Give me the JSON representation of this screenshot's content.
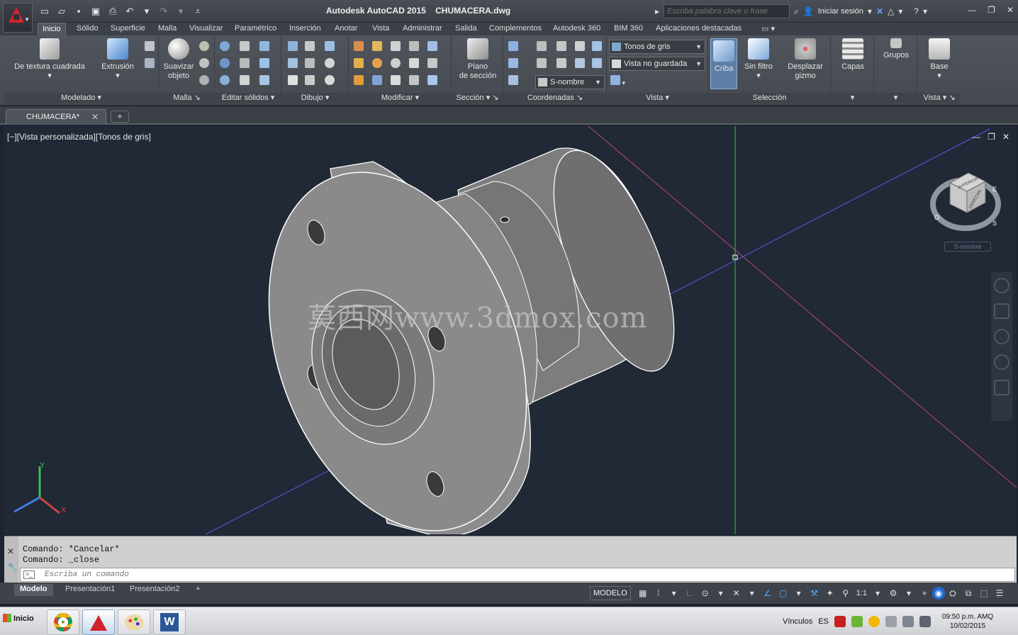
{
  "window": {
    "title": "Autodesk AutoCAD 2015    CHUMACERA.dwg",
    "search_placeholder": "Escriba palabra clave o frase",
    "signin_label": "Iniciar sesión"
  },
  "ribbon_tabs": [
    {
      "label": "Inicio",
      "active": true
    },
    {
      "label": "Sólido"
    },
    {
      "label": "Superficie"
    },
    {
      "label": "Malla"
    },
    {
      "label": "Visualizar"
    },
    {
      "label": "Paramétrico"
    },
    {
      "label": "Inserción"
    },
    {
      "label": "Anotar"
    },
    {
      "label": "Vista"
    },
    {
      "label": "Administrar"
    },
    {
      "label": "Salida"
    },
    {
      "label": "Complementos"
    },
    {
      "label": "Autodesk 360"
    },
    {
      "label": "BIM 360"
    },
    {
      "label": "Aplicaciones destacadas"
    }
  ],
  "panels": {
    "modelado": {
      "title": "Modelado",
      "btn1": "De textura cuadrada",
      "btn2": "Extrusión"
    },
    "malla": {
      "title": "Malla",
      "btn1a": "Suavizar",
      "btn1b": "objeto"
    },
    "editar_solidos": {
      "title": "Editar sólidos"
    },
    "dibujo": {
      "title": "Dibujo"
    },
    "modificar": {
      "title": "Modificar"
    },
    "seccion": {
      "title": "Sección",
      "btn_a": "Plano",
      "btn_b": "de sección"
    },
    "coordenadas": {
      "title": "Coordenadas",
      "ucs_combo": "S-nombre"
    },
    "vista": {
      "title": "Vista",
      "visual_style": "Tonos de gris",
      "named_view": "Vista no guardada"
    },
    "seleccion": {
      "title": "Selección",
      "criba": "Criba",
      "sin_filtro": "Sin filtro",
      "gizmo_a": "Desplazar",
      "gizmo_b": "gizmo"
    },
    "capas": {
      "label": "Capas"
    },
    "grupos": {
      "label": "Grupos"
    },
    "base": {
      "label": "Base",
      "title": "Vista"
    }
  },
  "file_tabs": [
    {
      "label": "CHUMACERA*"
    }
  ],
  "viewport": {
    "label": "[−][Vista personalizada][Tonos de gris]",
    "wcs_label": "S-nombre",
    "watermark": "莫西网www.3dmox.com",
    "viewcube": {
      "top": "SUPERIOR",
      "right": "DERECHA",
      "compass_n": "E",
      "compass_s": "S",
      "compass_o": "O"
    },
    "ucs_axes": {
      "x": "X",
      "y": "Y"
    }
  },
  "command": {
    "history": [
      "Comando: *Cancelar*",
      "Comando: _close"
    ],
    "placeholder": "Escriba un comando"
  },
  "layout_tabs": [
    {
      "label": "Modelo",
      "active": true
    },
    {
      "label": "Presentación1"
    },
    {
      "label": "Presentación2"
    }
  ],
  "status": {
    "model_label": "MODELO",
    "scale": "1:1"
  },
  "taskbar": {
    "start": "Inicio",
    "vinculos": "Vínculos",
    "lang": "ES",
    "time": "09:50 p.m. AMQ",
    "date": "10/02/2015"
  },
  "colors": {
    "viewport_bg": "#212836",
    "ribbon_bg": "#4b5058",
    "accent_blue": "#1f6bd6",
    "autocad_red": "#d0232a"
  }
}
